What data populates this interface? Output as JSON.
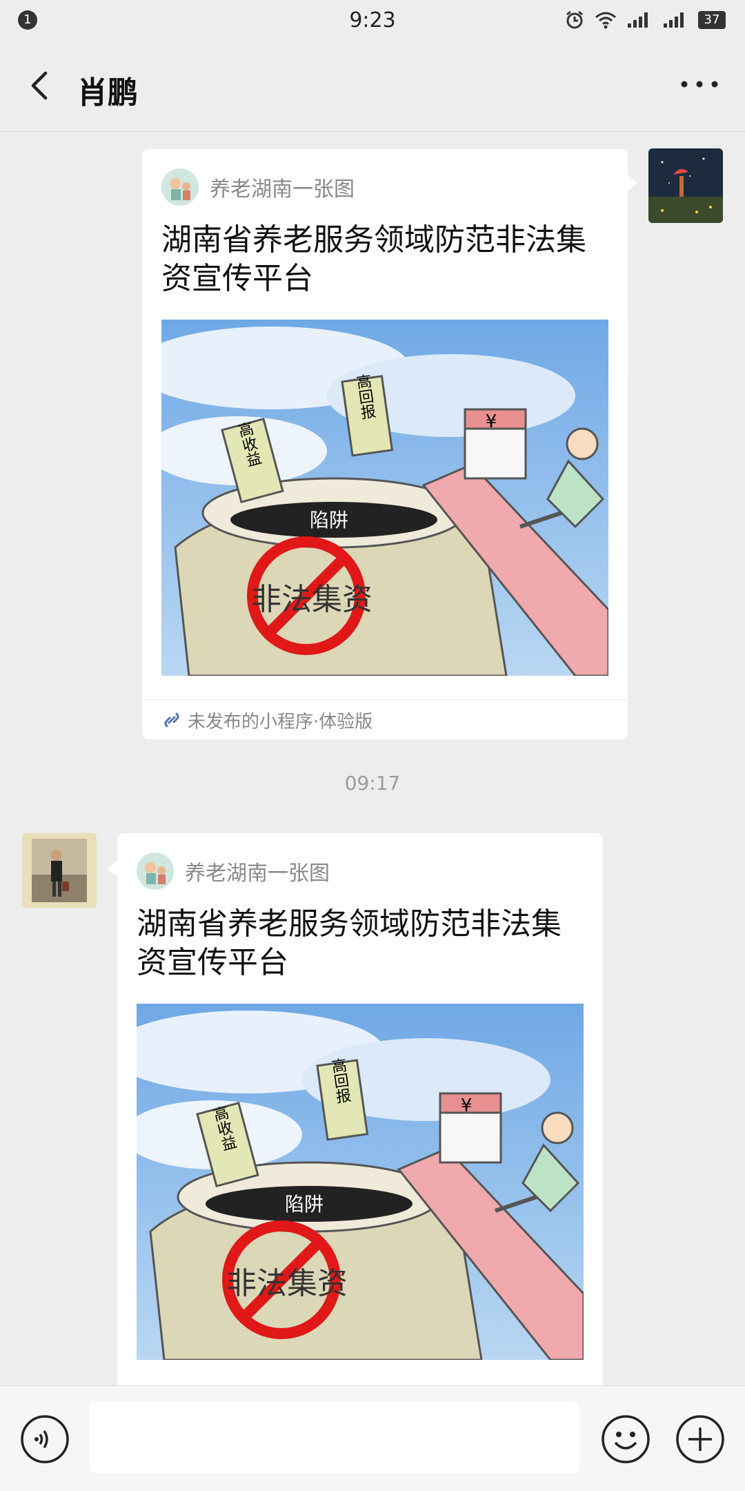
{
  "status": {
    "notification_count": "1",
    "time": "9:23",
    "battery": "37",
    "icons": [
      "alarm-icon",
      "wifi-icon",
      "signal-icon",
      "signal-2-icon",
      "battery-icon"
    ]
  },
  "nav": {
    "title": "肖鹏",
    "back_icon": "chevron-left-icon",
    "more_icon": "more-dots-icon"
  },
  "messages": [
    {
      "sender": "self",
      "source": "养老湖南一张图",
      "title": "湖南省养老服务领域防范非法集资宣传平台",
      "image": {
        "tags": [
          "高收益",
          "高回报",
          "陷阱",
          "非法集资",
          "¥"
        ]
      },
      "footer": "未发布的小程序·体验版"
    },
    {
      "sender": "other",
      "source": "养老湖南一张图",
      "title": "湖南省养老服务领域防范非法集资宣传平台",
      "image": {
        "tags": [
          "高收益",
          "高回报",
          "陷阱",
          "非法集资",
          "¥"
        ]
      }
    }
  ],
  "time_separator": "09:17",
  "input": {
    "value": "",
    "placeholder": ""
  },
  "colors": {
    "background": "#ededed",
    "card": "#ffffff",
    "sky": "#8fc0ec",
    "ban_red": "#e01818",
    "ramp_pink": "#f0a9ad"
  }
}
